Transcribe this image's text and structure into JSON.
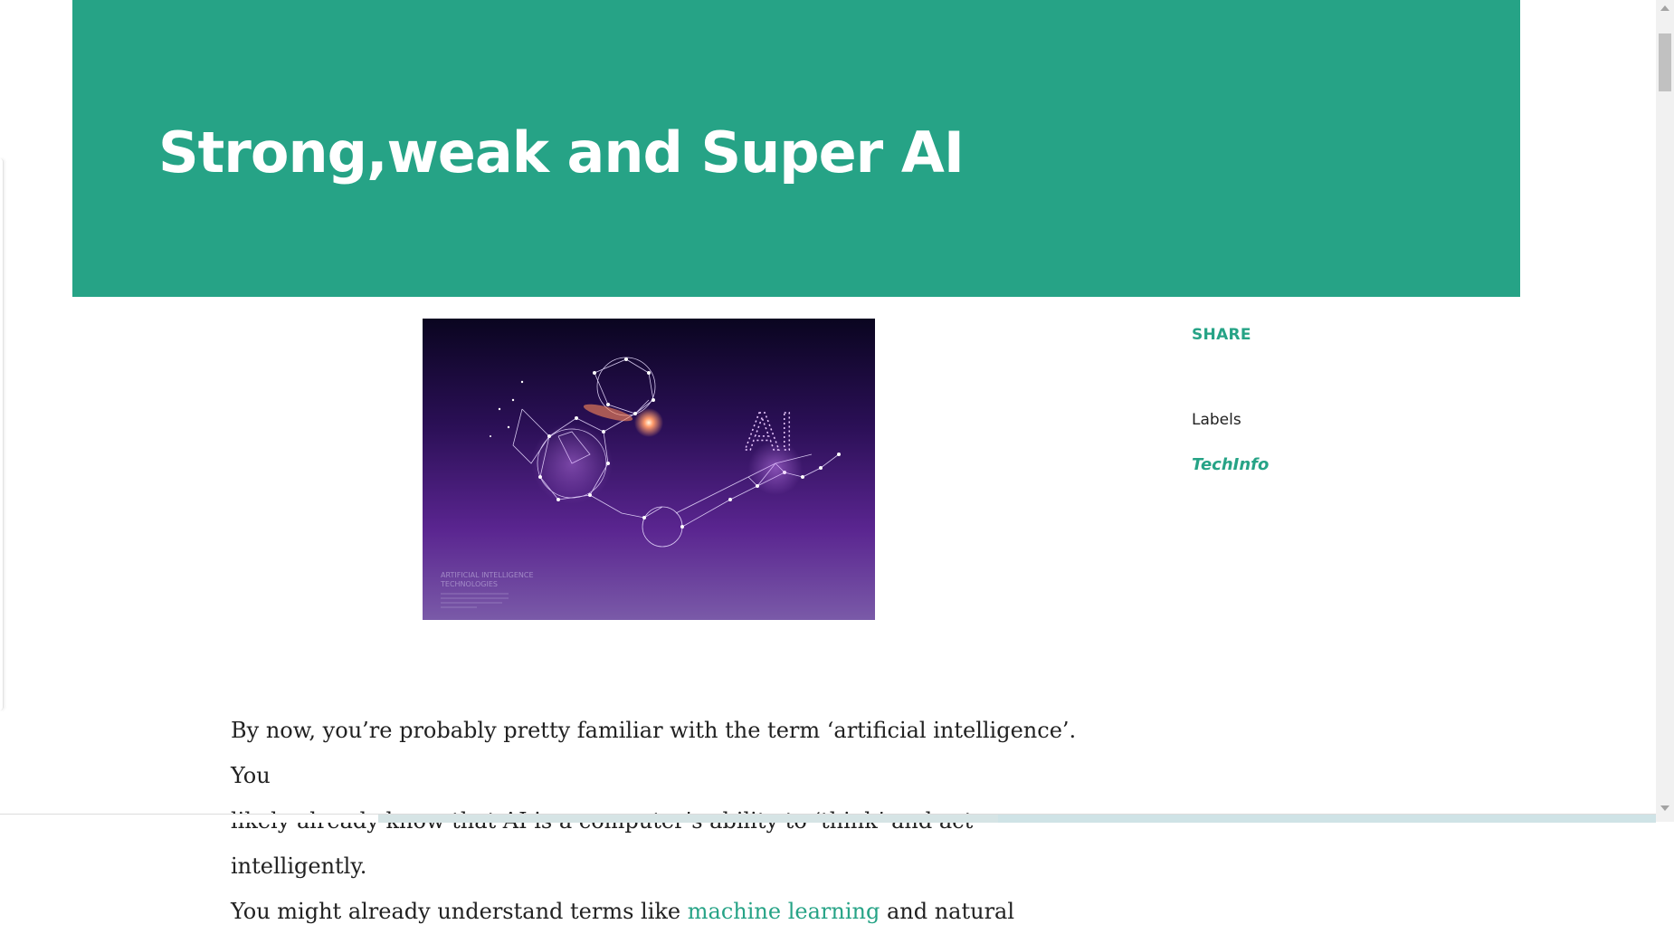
{
  "post": {
    "title": "Strong,weak and Super AI",
    "hero_image": {
      "caption_line1": "ARTIFICIAL INTELLIGENCE",
      "caption_line2": "TECHNOLOGIES",
      "ai_text": "AI"
    },
    "body": {
      "line1": "By now, you’re probably pretty familiar with the term ‘artificial intelligence’. You",
      "line2": "likely already know that AI is a computer’s ability to ‘think’ and act intelligently.",
      "line3_start": "You might already understand terms like ",
      "line3_link": "machine learning",
      "line3_end": " and natural"
    }
  },
  "sidebar": {
    "share_label": "SHARE",
    "labels_heading": "Labels",
    "label_items": [
      "TechInfo"
    ]
  },
  "colors": {
    "accent": "#26a386",
    "title_text": "#ffffff",
    "body_text": "#212121"
  },
  "icons": {
    "scroll_up": "triangle-up",
    "scroll_down": "triangle-down"
  }
}
